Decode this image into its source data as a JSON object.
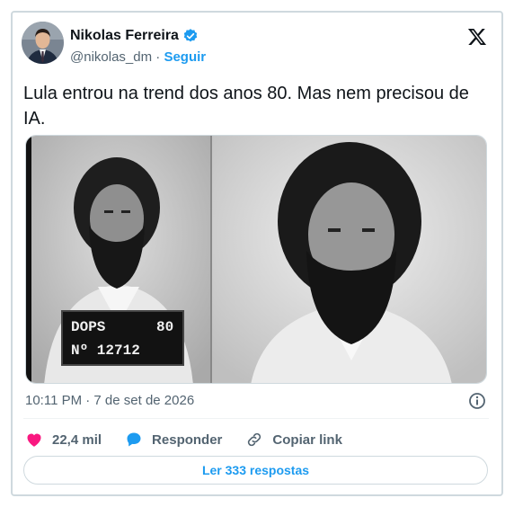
{
  "author": {
    "name": "Nikolas Ferreira",
    "handle": "@nikolas_dm",
    "separator": "·",
    "follow_label": "Seguir",
    "verified_badge_icon": "verified-badge-icon",
    "avatar_icon": "profile-photo"
  },
  "platform_logo": "x-logo-icon",
  "tweet": {
    "text": "Lula entrou na trend dos anos 80. Mas nem precisou de IA."
  },
  "media": {
    "photo_sign_line1": "DOPS",
    "photo_sign_number1": "80",
    "photo_sign_line2": "Nº 12712"
  },
  "meta": {
    "timestamp": "10:11 PM · 7 de set de 2026",
    "info_icon": "info-icon"
  },
  "actions": {
    "likes_count": "22,4 mil",
    "reply_label": "Responder",
    "copy_link_label": "Copiar link"
  },
  "read_replies_label": "Ler 333 respostas",
  "colors": {
    "accent": "#1d9bf0",
    "like": "#f91880",
    "text": "#0f1419",
    "muted": "#536471"
  }
}
